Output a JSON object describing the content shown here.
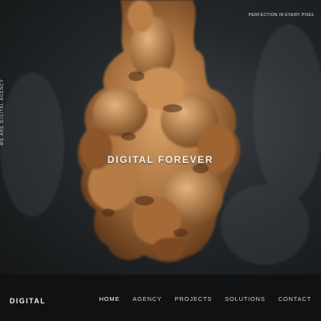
{
  "hero": {
    "side_text": "WE ARE DIGITAL AGENCY",
    "tagline": "PERFECTION IN EVERY PIXEL",
    "title": "DIGITAL FOREVER"
  },
  "nav": {
    "brand": "DIGITAL",
    "links": [
      {
        "label": "HOME",
        "active": true
      },
      {
        "label": "AGENCY",
        "active": false
      },
      {
        "label": "PROJECTS",
        "active": false
      },
      {
        "label": "SOLUTIONS",
        "active": false
      },
      {
        "label": "CONTACT",
        "active": false
      }
    ]
  },
  "colors": {
    "background": "#101112",
    "smoke": "#b07a45",
    "text": "#f2f2f2"
  }
}
